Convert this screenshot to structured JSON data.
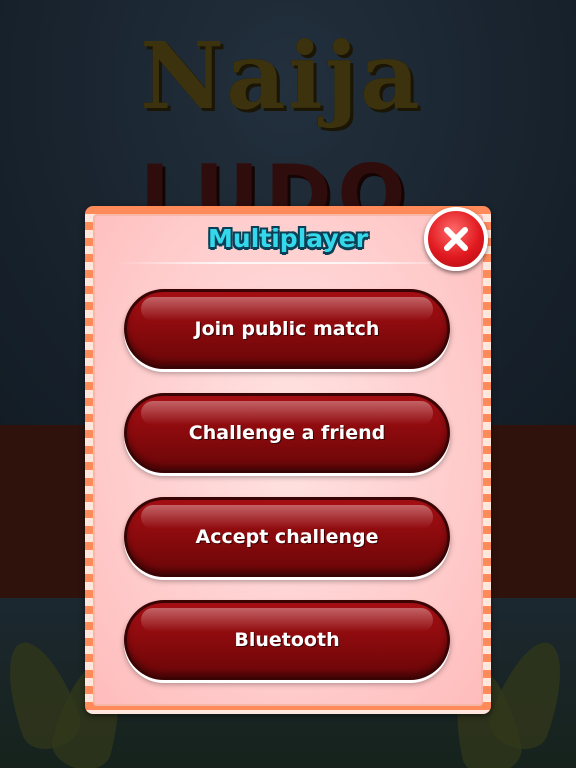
{
  "background": {
    "logo_line1": "Naija",
    "logo_line2": "LUDO"
  },
  "dialog": {
    "title": "Multiplayer",
    "close_icon": "close-x-icon",
    "buttons": [
      {
        "label": "Join public match"
      },
      {
        "label": "Challenge a friend"
      },
      {
        "label": "Accept challenge"
      },
      {
        "label": "Bluetooth"
      }
    ]
  },
  "colors": {
    "title_cyan": "#35d8ea",
    "button_red": "#8a0a0d",
    "dialog_pink": "#ffc9c9",
    "frame_orange": "#ff8a5a",
    "close_red": "#e0191f"
  }
}
